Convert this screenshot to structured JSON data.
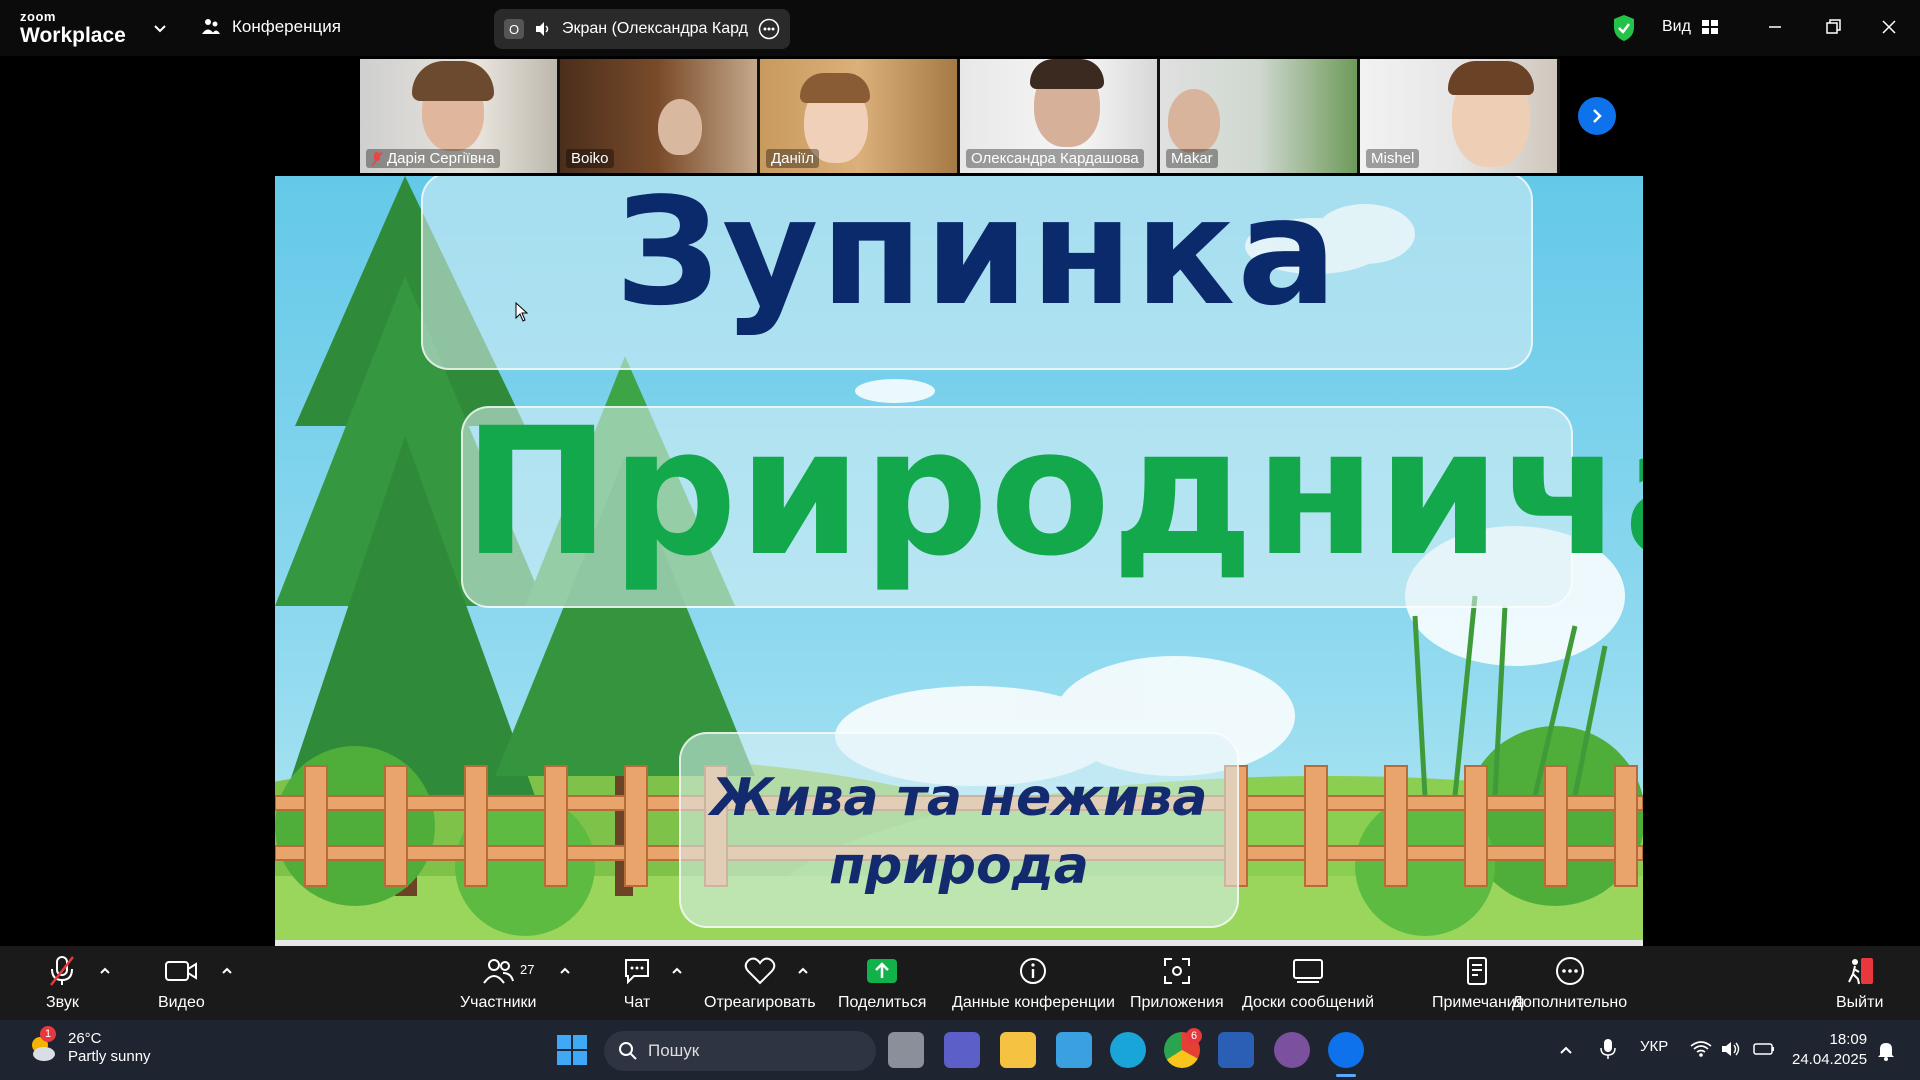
{
  "app": {
    "brand_top": "zoom",
    "brand_bottom": "Workplace",
    "meeting_label": "Конференция",
    "share_indicator": "Экран (Олександра Кардашова)",
    "share_badge": "O",
    "view_label": "Вид"
  },
  "participants_strip": [
    {
      "name": "Дарія Сергіївна",
      "muted": true
    },
    {
      "name": "Boiko",
      "active": true
    },
    {
      "name": "Даніїл"
    },
    {
      "name": "Олександра Кардашова"
    },
    {
      "name": "Makar"
    },
    {
      "name": "Mishel"
    }
  ],
  "slide": {
    "title_line1": "Зупинка",
    "title_line2": "Природнича",
    "subtitle_line1": "Жива та нежива",
    "subtitle_line2": "природа"
  },
  "controls": {
    "audio": "Звук",
    "video": "Видео",
    "participants": "Участники",
    "participants_count": "27",
    "chat": "Чат",
    "react": "Отреагировать",
    "share": "Поделиться",
    "meeting_info": "Данные конференции",
    "apps": "Приложения",
    "whiteboards": "Доски сообщений",
    "notes": "Примечания",
    "more": "Дополнительно",
    "leave": "Выйти"
  },
  "taskbar": {
    "weather_temp": "26°C",
    "weather_desc": "Partly sunny",
    "weather_badge": "1",
    "search_placeholder": "Пошук",
    "chrome_badge": "6",
    "language": "УКР",
    "time": "18:09",
    "date": "24.04.2025"
  },
  "colors": {
    "zoom_blue": "#0e72ed",
    "active_speaker": "#2ad34e",
    "share_green": "#12b24b",
    "leave_red": "#e8383d"
  }
}
